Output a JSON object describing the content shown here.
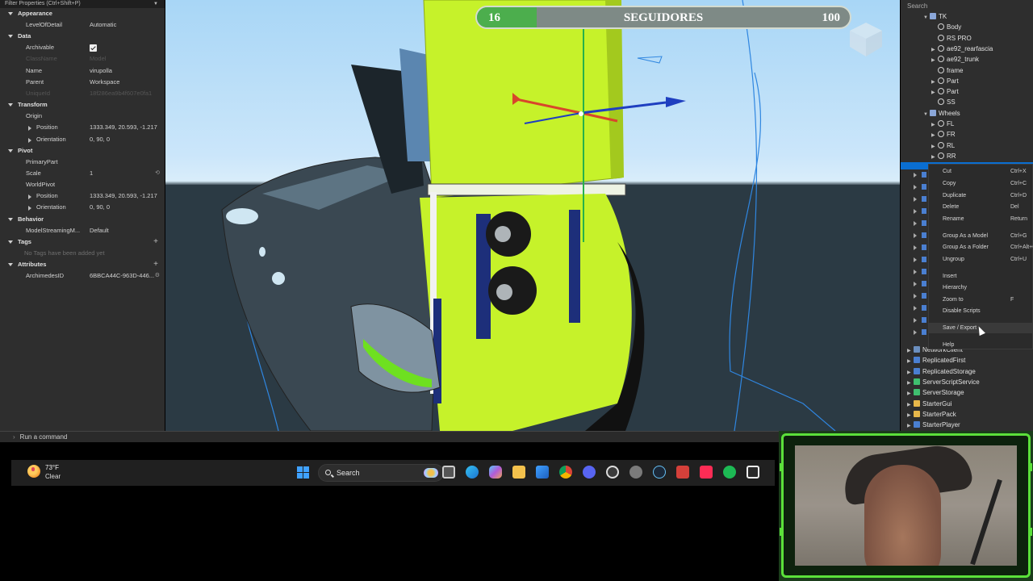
{
  "properties": {
    "header": "Filter Properties (Ctrl+Shift+P)",
    "sections": {
      "appearance": "Appearance",
      "data": "Data",
      "transform": "Transform",
      "pivot": "Pivot",
      "behavior": "Behavior",
      "tags": "Tags",
      "attributes": "Attributes"
    },
    "level_of_detail": {
      "key": "LevelOfDetail",
      "value": "Automatic"
    },
    "archivable": {
      "key": "Archivable",
      "checked": true
    },
    "class_name": {
      "key": "ClassName",
      "value": "Model"
    },
    "name": {
      "key": "Name",
      "value": "virupolla"
    },
    "parent": {
      "key": "Parent",
      "value": "Workspace"
    },
    "unique_id": {
      "key": "UniqueId",
      "value": "18f286ea9b4f607e0fa1"
    },
    "origin": {
      "key": "Origin"
    },
    "origin_position": {
      "key": "Position",
      "value": "1333.349, 20.593, -1.217"
    },
    "origin_orientation": {
      "key": "Orientation",
      "value": "0, 90, 0"
    },
    "primary_part": {
      "key": "PrimaryPart",
      "value": ""
    },
    "scale": {
      "key": "Scale",
      "value": "1"
    },
    "world_pivot": {
      "key": "WorldPivot"
    },
    "wp_position": {
      "key": "Position",
      "value": "1333.349, 20.593, -1.217"
    },
    "wp_orientation": {
      "key": "Orientation",
      "value": "0, 90, 0"
    },
    "model_streaming": {
      "key": "ModelStreamingM...",
      "value": "Default"
    },
    "no_tags": "No Tags have been added yet",
    "archimedes": {
      "key": "ArchimedesID",
      "value": "6BBCA44C-963D-446..."
    }
  },
  "hud": {
    "current": "16",
    "title": "SEGUIDORES",
    "goal": "100",
    "progress": 0.16
  },
  "explorer": {
    "search_placeholder": "Search",
    "items": [
      {
        "label": "TK",
        "indent": 2,
        "icon": "folder",
        "arrow": "down"
      },
      {
        "label": "Body",
        "indent": 3,
        "icon": "part"
      },
      {
        "label": "RS PRO",
        "indent": 3,
        "icon": "part"
      },
      {
        "label": "ae92_rearfascia",
        "indent": 3,
        "icon": "part",
        "arrow": "right"
      },
      {
        "label": "ae92_trunk",
        "indent": 3,
        "icon": "part",
        "arrow": "right"
      },
      {
        "label": "frame",
        "indent": 3,
        "icon": "part"
      },
      {
        "label": "Part",
        "indent": 3,
        "icon": "part",
        "arrow": "right"
      },
      {
        "label": "Part",
        "indent": 3,
        "icon": "part",
        "arrow": "right"
      },
      {
        "label": "SS",
        "indent": 3,
        "icon": "part"
      },
      {
        "label": "Wheels",
        "indent": 2,
        "icon": "folder",
        "arrow": "down"
      },
      {
        "label": "FL",
        "indent": 3,
        "icon": "part",
        "arrow": "right"
      },
      {
        "label": "FR",
        "indent": 3,
        "icon": "part",
        "arrow": "right"
      },
      {
        "label": "RL",
        "indent": 3,
        "icon": "part",
        "arrow": "right"
      },
      {
        "label": "RR",
        "indent": 3,
        "icon": "part",
        "arrow": "right"
      }
    ],
    "services": [
      {
        "label": "NetworkClient",
        "icon": "gray"
      },
      {
        "label": "ReplicatedFirst",
        "icon": "blue"
      },
      {
        "label": "ReplicatedStorage",
        "icon": "blue"
      },
      {
        "label": "ServerScriptService",
        "icon": "green"
      },
      {
        "label": "ServerStorage",
        "icon": "green"
      },
      {
        "label": "StarterGui",
        "icon": "yellow"
      },
      {
        "label": "StarterPack",
        "icon": "yellow"
      },
      {
        "label": "StarterPlayer",
        "icon": "blue"
      }
    ]
  },
  "context_menu": {
    "items": [
      {
        "label": "Cut",
        "shortcut": "Ctrl+X"
      },
      {
        "label": "Copy",
        "shortcut": "Ctrl+C"
      },
      {
        "label": "Duplicate",
        "shortcut": "Ctrl+D"
      },
      {
        "label": "Delete",
        "shortcut": "Del"
      },
      {
        "label": "Rename",
        "shortcut": "Return"
      },
      {
        "label": "Group As a Model",
        "shortcut": "Ctrl+G"
      },
      {
        "label": "Group As a Folder",
        "shortcut": "Ctrl+Alt+G"
      },
      {
        "label": "Ungroup",
        "shortcut": "Ctrl+U"
      },
      {
        "label": "Insert",
        "shortcut": ""
      },
      {
        "label": "Hierarchy",
        "shortcut": ""
      },
      {
        "label": "Zoom to",
        "shortcut": "F"
      },
      {
        "label": "Disable Scripts",
        "shortcut": ""
      },
      {
        "label": "Save / Export",
        "shortcut": ""
      },
      {
        "label": "Help",
        "shortcut": ""
      }
    ]
  },
  "command_bar": {
    "placeholder": "Run a command"
  },
  "taskbar": {
    "temperature": "73°F",
    "condition": "Clear",
    "search": "Search"
  },
  "colors": {
    "accent": "#0a6ed1",
    "hud_fill": "#4cae4d",
    "neon": "#c6f22a",
    "webcam_frame": "#5be03a"
  }
}
